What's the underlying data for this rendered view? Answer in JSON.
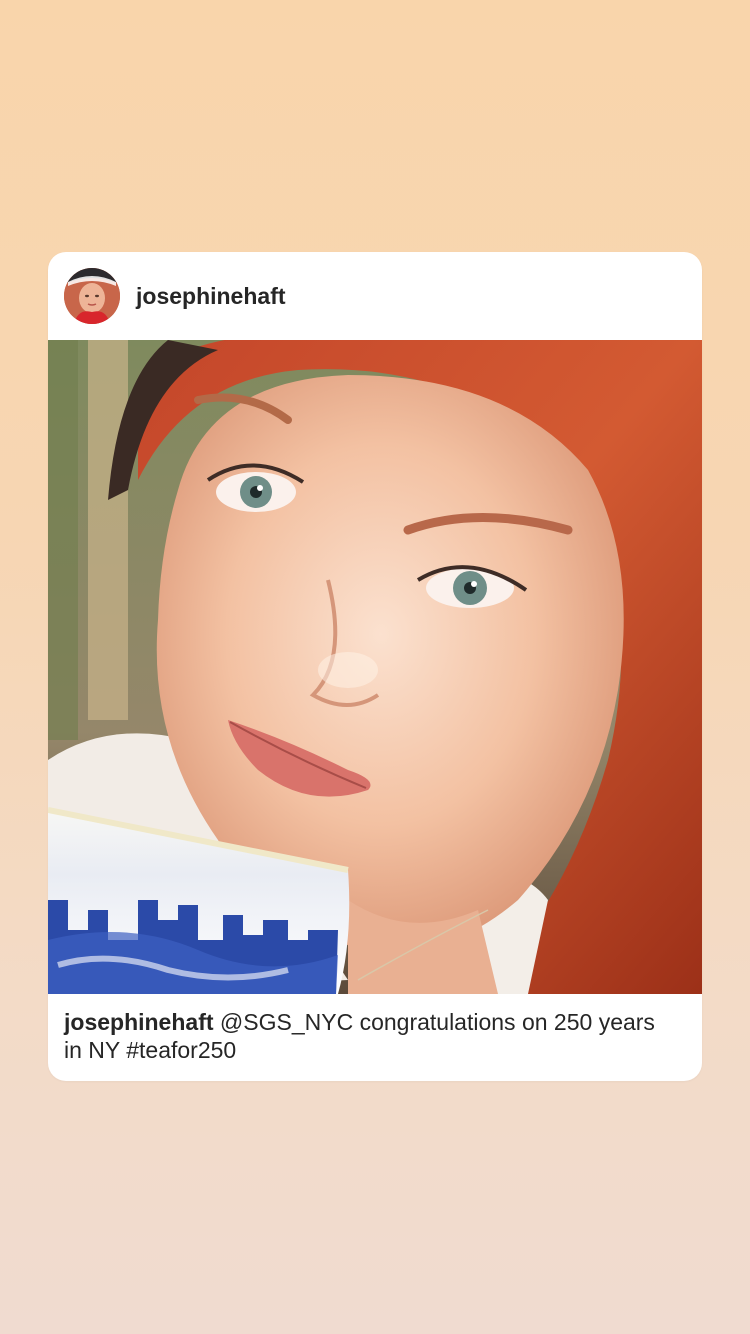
{
  "post": {
    "username": "josephinehaft",
    "caption_user": "josephinehaft",
    "caption_text": "@SGS_NYC congratulations on 250 years in NY #teafor250"
  },
  "colors": {
    "background_top": "#f9d5ab",
    "background_bottom": "#f0dbd0",
    "card": "#ffffff",
    "text": "#262626"
  },
  "icons": {
    "avatar": "profile-photo",
    "photo": "selfie-with-cup"
  }
}
